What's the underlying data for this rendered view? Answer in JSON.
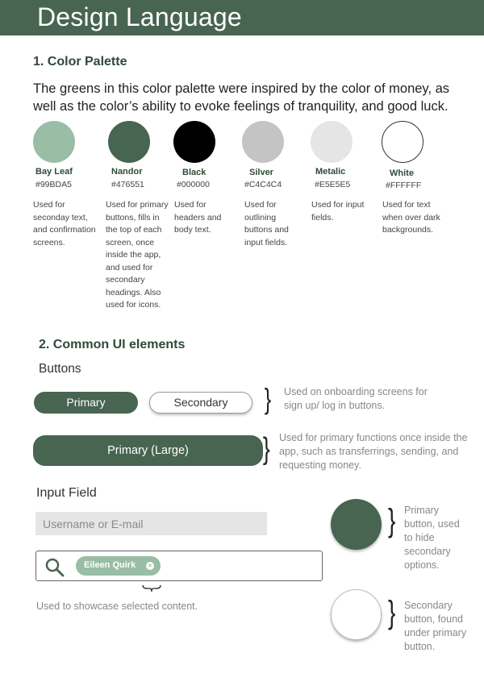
{
  "header": {
    "title": "Design Language"
  },
  "palette": {
    "title": "1. Color Palette",
    "intro": "The greens in this color palette were inspired by the color of money, as well as the color’s ability to evoke feelings of  tranquility, and good luck.",
    "swatches": [
      {
        "name": "Bay Leaf",
        "hex": "#99BDA5",
        "color": "#99BDA5",
        "desc": "Used for seconday text, and confirmation screens."
      },
      {
        "name": "Nandor",
        "hex": "#476551",
        "color": "#476551",
        "desc": "Used for primary buttons, fills in the top of each screen, once inside the app, and used for secondary headings. Also used for icons."
      },
      {
        "name": "Black",
        "hex": "#000000",
        "color": "#000000",
        "desc": "Used for headers and body text."
      },
      {
        "name": "Silver",
        "hex": "#C4C4C4",
        "color": "#C4C4C4",
        "desc": "Used for outlining buttons and input fields."
      },
      {
        "name": "Metalic",
        "hex": "#E5E5E5",
        "color": "#E5E5E5",
        "desc": "Used for input fields."
      },
      {
        "name": "White",
        "hex": "#FFFFFF",
        "color": "#FFFFFF",
        "desc": "Used for text when over dark backgrounds."
      }
    ]
  },
  "ui": {
    "title": "2. Common UI elements",
    "buttons": {
      "title": "Buttons",
      "primary_label": "Primary",
      "secondary_label": "Secondary",
      "small_note": "Used on onboarding screens for sign up/ log in buttons.",
      "large_label": "Primary (Large)",
      "large_note": "Used for primary functions once inside the app, such as transferrings, sending, and requesting money."
    },
    "input": {
      "title": "Input Field",
      "placeholder": "Username or E-mail",
      "chip_label": "Eileen Quirk",
      "chip_close": "×",
      "chip_note": "Used to showcase selected content."
    },
    "round": {
      "primary_note": "Primary button, used to hide secondary options.",
      "secondary_note": "Secondary button, found under primary button."
    },
    "brace_char": "}"
  },
  "colors": {
    "accent": "#476551",
    "light_accent": "#99BDA5",
    "note": "#888888"
  },
  "icons": {
    "search": "search-icon",
    "close": "close-icon"
  }
}
